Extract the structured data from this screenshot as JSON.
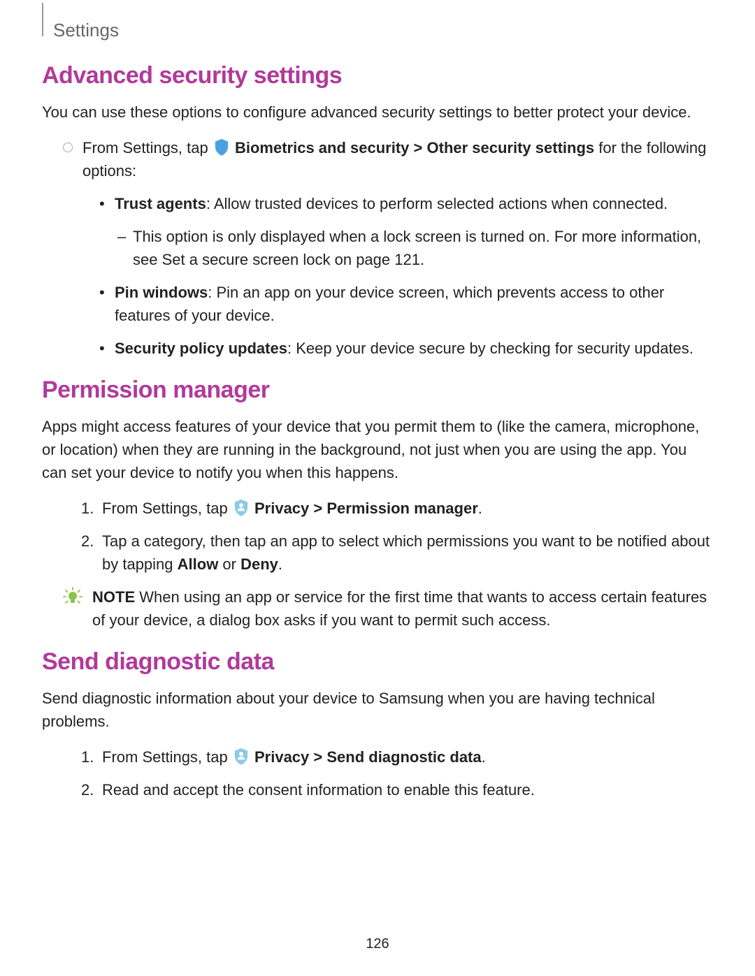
{
  "header": "Settings",
  "sec1": {
    "heading": "Advanced security settings",
    "intro": "You can use these options to configure advanced security settings to better protect your device.",
    "from_prefix": "From Settings, tap ",
    "from_bold1": "Biometrics and security",
    "from_chev": " > ",
    "from_bold2": "Other security settings",
    "from_suffix": " for the following options:",
    "b1_label": "Trust agents",
    "b1_text": ": Allow trusted devices to perform selected actions when connected.",
    "b1_dash_prefix": "This option is only displayed when a lock screen is turned on. For more information, see ",
    "b1_dash_link": "Set a secure screen lock",
    "b1_dash_suffix": " on page 121.",
    "b2_label": "Pin windows",
    "b2_text": ": Pin an app on your device screen, which prevents access to other features of your device.",
    "b3_label": "Security policy updates",
    "b3_text": ": Keep your device secure by checking for security updates."
  },
  "sec2": {
    "heading": "Permission manager",
    "intro": "Apps might access features of your device that you permit them to (like the camera, microphone, or location) when they are running in the background, not just when you are using the app. You can set your device to notify you when this happens.",
    "n1_num": "1.",
    "n1_prefix": "From Settings, tap ",
    "n1_bold1": "Privacy",
    "n1_chev": " > ",
    "n1_bold2": "Permission manager",
    "n1_suffix": ".",
    "n2_num": "2.",
    "n2_prefix": "Tap a category, then tap an app to select which permissions you want to be notified about by tapping ",
    "n2_bold1": "Allow",
    "n2_mid": " or ",
    "n2_bold2": "Deny",
    "n2_suffix": ".",
    "note_label": "NOTE",
    "note_text": "  When using an app or service for the first time that wants to access certain features of your device, a dialog box asks if you want to permit such access."
  },
  "sec3": {
    "heading": "Send diagnostic data",
    "intro": "Send diagnostic information about your device to Samsung when you are having technical problems.",
    "n1_num": "1.",
    "n1_prefix": "From Settings, tap ",
    "n1_bold1": "Privacy",
    "n1_chev": " > ",
    "n1_bold2": "Send diagnostic data",
    "n1_suffix": ".",
    "n2_num": "2.",
    "n2_text": "Read and accept the consent information to enable this feature."
  },
  "page_num": "126"
}
